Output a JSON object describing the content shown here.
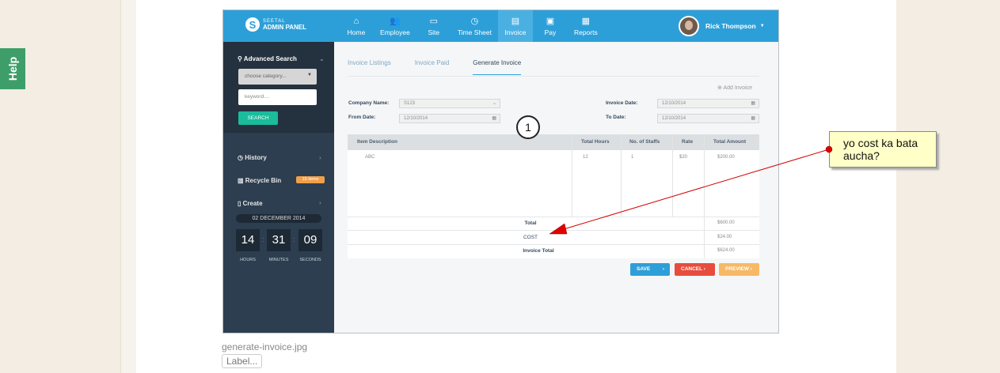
{
  "help_label": "Help",
  "app": {
    "logo_small": "SEETAL",
    "logo_text": "ADMIN PANEL",
    "nav": [
      {
        "label": "Home",
        "icon": "home-icon",
        "glyph": "⌂"
      },
      {
        "label": "Employee",
        "icon": "employee-icon",
        "glyph": "👥"
      },
      {
        "label": "Site",
        "icon": "monitor-icon",
        "glyph": "▭"
      },
      {
        "label": "Time Sheet",
        "icon": "clock-icon",
        "glyph": "◷"
      },
      {
        "label": "Invoice",
        "icon": "invoice-icon",
        "glyph": "▤"
      },
      {
        "label": "Pay",
        "icon": "money-icon",
        "glyph": "▣"
      },
      {
        "label": "Reports",
        "icon": "report-icon",
        "glyph": "▦"
      }
    ],
    "user_name": "Rick Thompson"
  },
  "sidebar": {
    "advanced_search": "Advanced Search",
    "category_placeholder": "choose category...",
    "keyword_placeholder": "keyword....",
    "search_button": "SEARCH",
    "history": "History",
    "recycle_bin": "Recycle Bin",
    "recycle_badge": "15 items",
    "create": "Create",
    "date": "02 DECEMBER 2014",
    "hours": "14",
    "minutes": "31",
    "seconds": "09",
    "hours_label": "HOURS",
    "minutes_label": "MINUTES",
    "seconds_label": "SECONDS"
  },
  "main": {
    "tabs": [
      "Invoice Listings",
      "Invoice Paid",
      "Generate Invoice"
    ],
    "add_invoice": "Add Invoice",
    "company_name_label": "Company Name:",
    "company_name_value": "S123",
    "from_date_label": "From Date:",
    "from_date_value": "12/10/2014",
    "invoice_date_label": "Invoice Date:",
    "invoice_date_value": "12/10/2014",
    "to_date_label": "To Date:",
    "to_date_value": "12/10/2014",
    "table": {
      "headers": [
        "Item Description",
        "Total Hours",
        "No. of Staffs",
        "Rate",
        "Total Amount"
      ],
      "row": [
        "ABC",
        "12",
        "1",
        "$20",
        "$200.00"
      ],
      "total_label": "Total",
      "total_value": "$600.00",
      "cost_label": "COST",
      "cost_value": "$24.00",
      "invoice_total_label": "Invoice Total",
      "invoice_total_value": "$624.00"
    },
    "save": "SAVE",
    "cancel": "CANCEL",
    "preview": "PREVIEW"
  },
  "annotation": {
    "number": "1",
    "note": "yo cost ka bata aucha?"
  },
  "caption": "generate-invoice.jpg",
  "label_button": "Label..."
}
